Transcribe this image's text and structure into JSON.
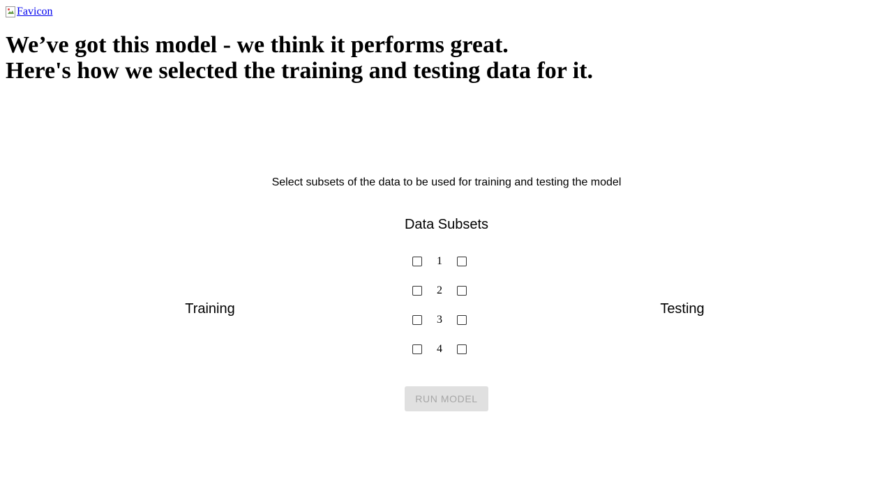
{
  "header": {
    "favicon_alt": "Favicon"
  },
  "headline": {
    "line1": "We’ve got this model - we think it performs great.",
    "line2": "Here's how we selected the training and testing data for it."
  },
  "instructions": "Select subsets of the data to be used for training and testing the model",
  "subsets": {
    "title": "Data Subsets",
    "training_label": "Training",
    "testing_label": "Testing",
    "items": [
      {
        "label": "1",
        "training_checked": false,
        "testing_checked": false
      },
      {
        "label": "2",
        "training_checked": false,
        "testing_checked": false
      },
      {
        "label": "3",
        "training_checked": false,
        "testing_checked": false
      },
      {
        "label": "4",
        "training_checked": false,
        "testing_checked": false
      }
    ]
  },
  "run_button": {
    "label": "RUN MODEL",
    "disabled": true
  }
}
